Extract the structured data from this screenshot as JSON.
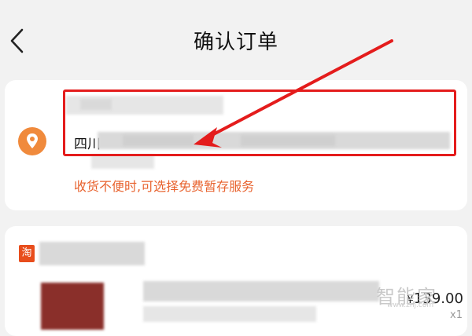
{
  "header": {
    "title": "确认订单"
  },
  "address": {
    "prefix": "四川",
    "hint": "收货不便时,可选择免费暂存服务"
  },
  "shop": {
    "badge": "淘"
  },
  "product": {
    "currency": "¥",
    "price": "139.00",
    "qty": "x1"
  },
  "watermark": {
    "text": "智能家",
    "url": "www.znj.com"
  },
  "colors": {
    "accent": "#e8632f",
    "highlight": "#e41c1c",
    "badge": "#e84d1c"
  },
  "icons": {
    "back": "chevron-left-icon",
    "location": "location-pin-icon"
  }
}
